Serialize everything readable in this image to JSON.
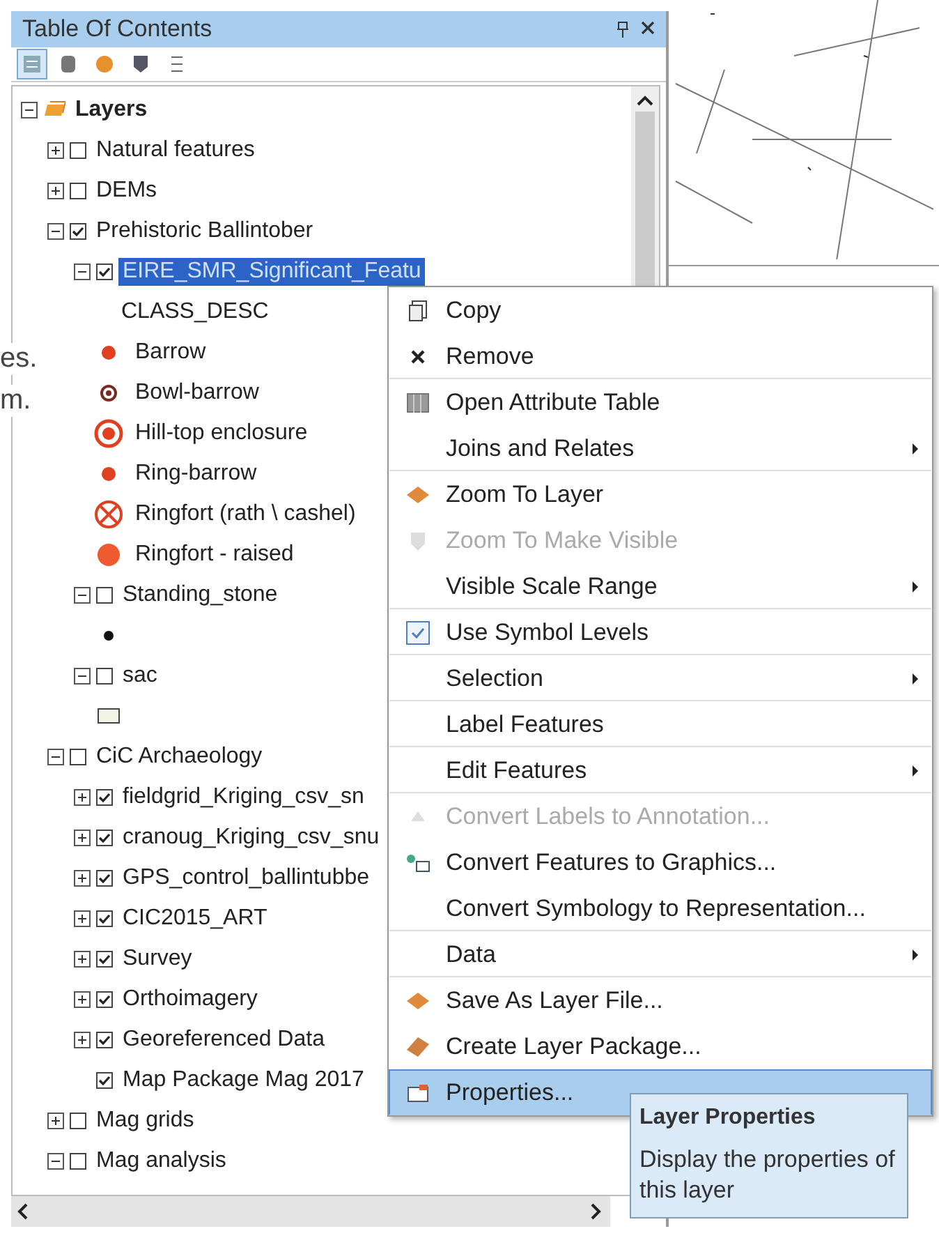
{
  "page_fragments": [
    "es.",
    "m."
  ],
  "panel": {
    "title": "Table Of Contents",
    "toolbar": [
      {
        "selected": true
      },
      {
        "selected": false
      },
      {
        "selected": false
      },
      {
        "selected": false
      },
      {
        "selected": false
      }
    ],
    "tree": [
      {
        "kind": "frame",
        "label": "Layers",
        "expanded": true,
        "children": [
          {
            "kind": "layer",
            "label": "Natural features",
            "expanded": false,
            "checked": false
          },
          {
            "kind": "layer",
            "label": "DEMs",
            "expanded": false,
            "checked": false
          },
          {
            "kind": "layer",
            "label": "Prehistoric Ballintober",
            "expanded": true,
            "checked": true,
            "children": [
              {
                "kind": "layer",
                "label": "EIRE_SMR_Significant_Featu",
                "expanded": true,
                "checked": true,
                "selected": true,
                "children": [
                  {
                    "kind": "heading",
                    "label": "CLASS_DESC"
                  },
                  {
                    "kind": "dot",
                    "label": "Barrow"
                  },
                  {
                    "kind": "bullseye",
                    "label": "Bowl-barrow"
                  },
                  {
                    "kind": "ring",
                    "label": "Hill-top enclosure"
                  },
                  {
                    "kind": "dot",
                    "label": "Ring-barrow"
                  },
                  {
                    "kind": "crossed",
                    "label": "Ringfort (rath \\ cashel)"
                  },
                  {
                    "kind": "blob",
                    "label": "Ringfort - raised"
                  }
                ]
              },
              {
                "kind": "layer",
                "label": "Standing_stone",
                "expanded": true,
                "checked": false,
                "selected": false,
                "children": [
                  {
                    "kind": "point"
                  }
                ]
              },
              {
                "kind": "layer",
                "label": "sac",
                "expanded": true,
                "checked": false,
                "selected": false,
                "children": [
                  {
                    "kind": "swatch"
                  }
                ]
              }
            ]
          },
          {
            "kind": "layer",
            "label": "CiC Archaeology",
            "expanded": true,
            "checked": false,
            "children": [
              {
                "kind": "layer",
                "label": "fieldgrid_Kriging_csv_sn",
                "expanded": false,
                "checked": true
              },
              {
                "kind": "layer",
                "label": "cranoug_Kriging_csv_snu",
                "expanded": false,
                "checked": true
              },
              {
                "kind": "layer",
                "label": "GPS_control_ballintubbe",
                "expanded": false,
                "checked": true
              },
              {
                "kind": "layer",
                "label": "CIC2015_ART",
                "expanded": false,
                "checked": true
              },
              {
                "kind": "layer",
                "label": "Survey",
                "expanded": false,
                "checked": true
              },
              {
                "kind": "layer",
                "label": "Orthoimagery",
                "expanded": false,
                "checked": true
              },
              {
                "kind": "layer",
                "label": "Georeferenced Data",
                "expanded": false,
                "checked": true
              },
              {
                "kind": "layer",
                "label": "Map Package Mag 2017",
                "checked": true
              }
            ]
          },
          {
            "kind": "layer",
            "label": "Mag grids",
            "expanded": false,
            "checked": false
          },
          {
            "kind": "layer",
            "label": "Mag analysis",
            "expanded": true,
            "checked": false
          }
        ]
      }
    ]
  },
  "context_menu": [
    {
      "label": "Copy",
      "disabled": false,
      "submenu": false,
      "selected": false,
      "separator_after": false
    },
    {
      "label": "Remove",
      "disabled": false,
      "submenu": false,
      "selected": false,
      "separator_after": true
    },
    {
      "label": "Open Attribute Table",
      "disabled": false,
      "submenu": false,
      "selected": false,
      "separator_after": false
    },
    {
      "label": "Joins and Relates",
      "disabled": false,
      "submenu": true,
      "selected": false,
      "separator_after": true
    },
    {
      "label": "Zoom To Layer",
      "disabled": false,
      "submenu": false,
      "selected": false,
      "separator_after": false
    },
    {
      "label": "Zoom To Make Visible",
      "disabled": true,
      "submenu": false,
      "selected": false,
      "separator_after": false
    },
    {
      "label": "Visible Scale Range",
      "disabled": false,
      "submenu": true,
      "selected": false,
      "separator_after": true
    },
    {
      "label": "Use Symbol Levels",
      "disabled": false,
      "submenu": false,
      "selected": false,
      "separator_after": true
    },
    {
      "label": "Selection",
      "disabled": false,
      "submenu": true,
      "selected": false,
      "separator_after": true
    },
    {
      "label": "Label Features",
      "disabled": false,
      "submenu": false,
      "selected": false,
      "separator_after": true
    },
    {
      "label": "Edit Features",
      "disabled": false,
      "submenu": true,
      "selected": false,
      "separator_after": true
    },
    {
      "label": "Convert Labels to Annotation...",
      "disabled": true,
      "submenu": false,
      "selected": false,
      "separator_after": false
    },
    {
      "label": "Convert Features to Graphics...",
      "disabled": false,
      "submenu": false,
      "selected": false,
      "separator_after": false
    },
    {
      "label": "Convert Symbology to Representation...",
      "disabled": false,
      "submenu": false,
      "selected": false,
      "separator_after": true
    },
    {
      "label": "Data",
      "disabled": false,
      "submenu": true,
      "selected": false,
      "separator_after": true
    },
    {
      "label": "Save As Layer File...",
      "disabled": false,
      "submenu": false,
      "selected": false,
      "separator_after": false
    },
    {
      "label": "Create Layer Package...",
      "disabled": false,
      "submenu": false,
      "selected": false,
      "separator_after": false
    },
    {
      "label": "Properties...",
      "disabled": false,
      "submenu": false,
      "selected": true,
      "separator_after": false
    }
  ],
  "tooltip": {
    "title": "Layer Properties",
    "text": "Display the properties of this layer"
  }
}
